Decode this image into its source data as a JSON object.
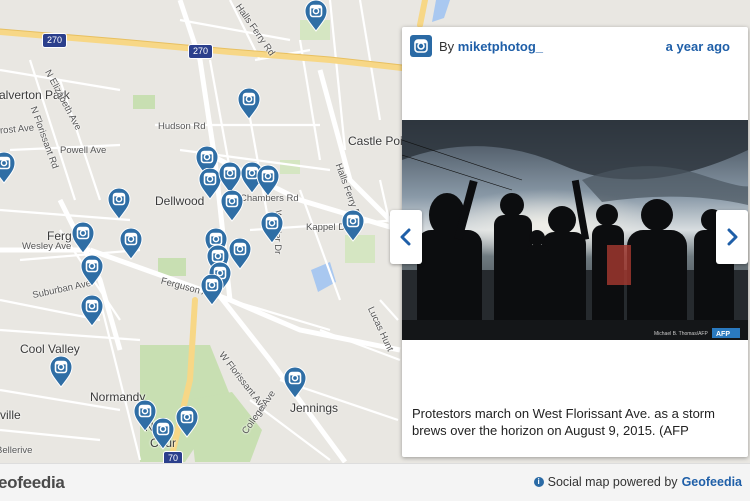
{
  "map": {
    "places": [
      {
        "id": "calverton-park",
        "label": "alverton Park"
      },
      {
        "id": "castle-point",
        "label": "Castle Poi"
      },
      {
        "id": "dellwood",
        "label": "Dellwood"
      },
      {
        "id": "ferguson",
        "label": "Fergu"
      },
      {
        "id": "cool-valley",
        "label": "Cool Valley"
      },
      {
        "id": "normandy",
        "label": "Normandy"
      },
      {
        "id": "jennings",
        "label": "Jennings"
      },
      {
        "id": "north-county",
        "label": "No"
      },
      {
        "id": "countr",
        "label": "Cour"
      },
      {
        "id": "ville",
        "label": "ville"
      },
      {
        "id": "bellerive",
        "label": "Bellerive"
      }
    ],
    "roads": [
      {
        "id": "n-elizabeth-ave",
        "label": "N Elizabeth Ave"
      },
      {
        "id": "frost-ave",
        "label": "rost Ave"
      },
      {
        "id": "n-florissant-rd",
        "label": "N Florissant Rd"
      },
      {
        "id": "powell-ave",
        "label": "Powell Ave"
      },
      {
        "id": "hudson-rd",
        "label": "Hudson Rd"
      },
      {
        "id": "chambers-rd",
        "label": "Chambers Rd"
      },
      {
        "id": "kappel-dr",
        "label": "Kappel Dr"
      },
      {
        "id": "winkler-dr",
        "label": "Winkler Dr"
      },
      {
        "id": "halls-ferry-rd",
        "label": "Halls Ferry Rd"
      },
      {
        "id": "halls-ferry-rd-top",
        "label": "Halls Ferry Rd"
      },
      {
        "id": "wesley-ave",
        "label": "Wesley Ave"
      },
      {
        "id": "suburban-ave",
        "label": "Suburban Ave"
      },
      {
        "id": "ferguson-ave",
        "label": "Ferguson Ave"
      },
      {
        "id": "florissant-ave",
        "label": "W Florissant Ave"
      },
      {
        "id": "college-ave",
        "label": "College Ave"
      },
      {
        "id": "lucas-hunt",
        "label": "Lucas Hunt"
      }
    ],
    "shields": [
      {
        "id": "i270-left",
        "label": "270"
      },
      {
        "id": "i270-mid",
        "label": "270"
      },
      {
        "id": "i70",
        "label": "70"
      }
    ],
    "marker_icon": "instagram-icon",
    "marker_color": "#2f6ea5"
  },
  "card": {
    "by_label": "By",
    "username": "miketphotog_",
    "time": "a year ago",
    "photo_credit": "Michael B. Thomas/AFP",
    "photo_badge": "AFP",
    "caption": "Protestors march on West Florissant Ave. as a storm brews over the horizon on August 9, 2015. (AFP"
  },
  "nav": {
    "prev_icon": "chevron-left-icon",
    "next_icon": "chevron-right-icon"
  },
  "footer": {
    "logo": "eofeedia",
    "powered_text": "Social map powered by",
    "brand": "Geofeedia"
  },
  "colors": {
    "accent": "#1f5fa8",
    "marker": "#2f6ea5"
  }
}
